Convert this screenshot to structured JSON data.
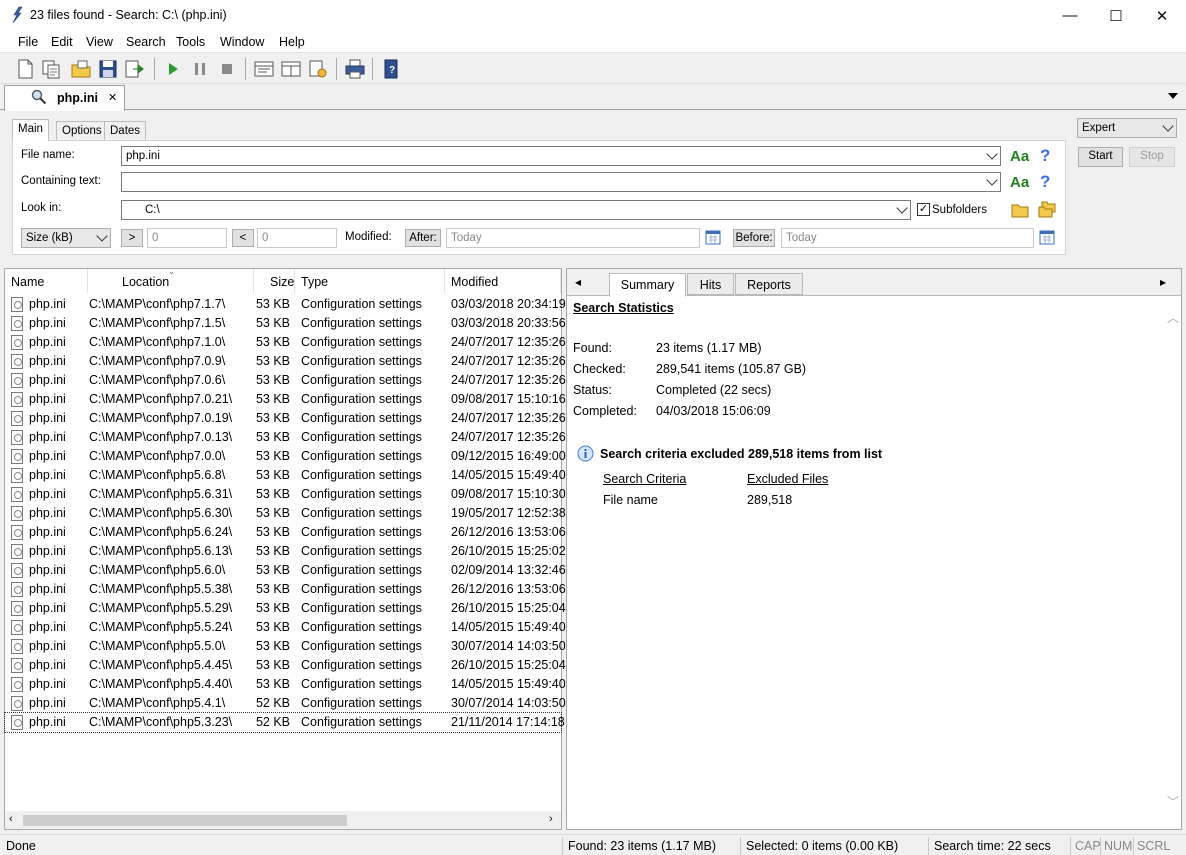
{
  "window": {
    "title": "23 files found - Search: C:\\ (php.ini)",
    "minimize": "—",
    "maximize": "☐",
    "close": "✕"
  },
  "menu": [
    "File",
    "Edit",
    "View",
    "Search",
    "Tools",
    "Window",
    "Help"
  ],
  "doc_tab": {
    "label": "php.ini",
    "close": "✕"
  },
  "criteria": {
    "tabs": [
      "Main",
      "Options",
      "Dates"
    ],
    "file_name_label": "File name:",
    "file_name_value": "php.ini",
    "containing_text_label": "Containing text:",
    "containing_text_value": "",
    "look_in_label": "Look in:",
    "look_in_value": "C:\\",
    "subfolders_label": "Subfolders",
    "subfolders_checked": true,
    "size_select": "Size (kB)",
    "gt_label": ">",
    "gt_value": "0",
    "lt_label": "<",
    "lt_value": "0",
    "modified_label": "Modified:",
    "after_label": "After:",
    "after_value": "Today",
    "before_label": "Before:",
    "before_value": "Today",
    "aa": "Aa",
    "help": "?"
  },
  "mode_select": "Expert",
  "start_label": "Start",
  "stop_label": "Stop",
  "columns": [
    "Name",
    "Location",
    "Size",
    "Type",
    "Modified"
  ],
  "rows": [
    {
      "name": "php.ini",
      "location": "C:\\MAMP\\conf\\php7.1.7\\",
      "size": "53 KB",
      "type": "Configuration settings",
      "modified": "03/03/2018 20:34:19"
    },
    {
      "name": "php.ini",
      "location": "C:\\MAMP\\conf\\php7.1.5\\",
      "size": "53 KB",
      "type": "Configuration settings",
      "modified": "03/03/2018 20:33:56"
    },
    {
      "name": "php.ini",
      "location": "C:\\MAMP\\conf\\php7.1.0\\",
      "size": "53 KB",
      "type": "Configuration settings",
      "modified": "24/07/2017 12:35:26"
    },
    {
      "name": "php.ini",
      "location": "C:\\MAMP\\conf\\php7.0.9\\",
      "size": "53 KB",
      "type": "Configuration settings",
      "modified": "24/07/2017 12:35:26"
    },
    {
      "name": "php.ini",
      "location": "C:\\MAMP\\conf\\php7.0.6\\",
      "size": "53 KB",
      "type": "Configuration settings",
      "modified": "24/07/2017 12:35:26"
    },
    {
      "name": "php.ini",
      "location": "C:\\MAMP\\conf\\php7.0.21\\",
      "size": "53 KB",
      "type": "Configuration settings",
      "modified": "09/08/2017 15:10:16"
    },
    {
      "name": "php.ini",
      "location": "C:\\MAMP\\conf\\php7.0.19\\",
      "size": "53 KB",
      "type": "Configuration settings",
      "modified": "24/07/2017 12:35:26"
    },
    {
      "name": "php.ini",
      "location": "C:\\MAMP\\conf\\php7.0.13\\",
      "size": "53 KB",
      "type": "Configuration settings",
      "modified": "24/07/2017 12:35:26"
    },
    {
      "name": "php.ini",
      "location": "C:\\MAMP\\conf\\php7.0.0\\",
      "size": "53 KB",
      "type": "Configuration settings",
      "modified": "09/12/2015 16:49:00"
    },
    {
      "name": "php.ini",
      "location": "C:\\MAMP\\conf\\php5.6.8\\",
      "size": "53 KB",
      "type": "Configuration settings",
      "modified": "14/05/2015 15:49:40"
    },
    {
      "name": "php.ini",
      "location": "C:\\MAMP\\conf\\php5.6.31\\",
      "size": "53 KB",
      "type": "Configuration settings",
      "modified": "09/08/2017 15:10:30"
    },
    {
      "name": "php.ini",
      "location": "C:\\MAMP\\conf\\php5.6.30\\",
      "size": "53 KB",
      "type": "Configuration settings",
      "modified": "19/05/2017 12:52:38"
    },
    {
      "name": "php.ini",
      "location": "C:\\MAMP\\conf\\php5.6.24\\",
      "size": "53 KB",
      "type": "Configuration settings",
      "modified": "26/12/2016 13:53:06"
    },
    {
      "name": "php.ini",
      "location": "C:\\MAMP\\conf\\php5.6.13\\",
      "size": "53 KB",
      "type": "Configuration settings",
      "modified": "26/10/2015 15:25:02"
    },
    {
      "name": "php.ini",
      "location": "C:\\MAMP\\conf\\php5.6.0\\",
      "size": "53 KB",
      "type": "Configuration settings",
      "modified": "02/09/2014 13:32:46"
    },
    {
      "name": "php.ini",
      "location": "C:\\MAMP\\conf\\php5.5.38\\",
      "size": "53 KB",
      "type": "Configuration settings",
      "modified": "26/12/2016 13:53:06"
    },
    {
      "name": "php.ini",
      "location": "C:\\MAMP\\conf\\php5.5.29\\",
      "size": "53 KB",
      "type": "Configuration settings",
      "modified": "26/10/2015 15:25:04"
    },
    {
      "name": "php.ini",
      "location": "C:\\MAMP\\conf\\php5.5.24\\",
      "size": "53 KB",
      "type": "Configuration settings",
      "modified": "14/05/2015 15:49:40"
    },
    {
      "name": "php.ini",
      "location": "C:\\MAMP\\conf\\php5.5.0\\",
      "size": "53 KB",
      "type": "Configuration settings",
      "modified": "30/07/2014 14:03:50"
    },
    {
      "name": "php.ini",
      "location": "C:\\MAMP\\conf\\php5.4.45\\",
      "size": "53 KB",
      "type": "Configuration settings",
      "modified": "26/10/2015 15:25:04"
    },
    {
      "name": "php.ini",
      "location": "C:\\MAMP\\conf\\php5.4.40\\",
      "size": "53 KB",
      "type": "Configuration settings",
      "modified": "14/05/2015 15:49:40"
    },
    {
      "name": "php.ini",
      "location": "C:\\MAMP\\conf\\php5.4.1\\",
      "size": "52 KB",
      "type": "Configuration settings",
      "modified": "30/07/2014 14:03:50"
    },
    {
      "name": "php.ini",
      "location": "C:\\MAMP\\conf\\php5.3.23\\",
      "size": "52 KB",
      "type": "Configuration settings",
      "modified": "21/11/2014 17:14:18"
    }
  ],
  "results_tabs": [
    "Summary",
    "Hits",
    "Reports"
  ],
  "summary": {
    "heading": "Search Statistics",
    "found_label": "Found:",
    "found_value": "23 items (1.17 MB)",
    "checked_label": "Checked:",
    "checked_value": "289,541 items (105.87 GB)",
    "status_label": "Status:",
    "status_value": "Completed (22 secs)",
    "completed_label": "Completed:",
    "completed_value": "04/03/2018 15:06:09",
    "excluded_note": "Search criteria excluded 289,518 items from list",
    "criteria_header": "Search Criteria",
    "excluded_header": "Excluded Files",
    "criteria_name": "File name",
    "criteria_count": "289,518"
  },
  "statusbar": {
    "left": "Done",
    "found": "Found: 23 items (1.17 MB)",
    "selected": "Selected: 0 items (0.00 KB)",
    "time": "Search time: 22 secs",
    "cap": "CAP",
    "num": "NUM",
    "scrl": "SCRL"
  },
  "colors": {
    "accent_green": "#208020",
    "help_blue": "#3b6fd6",
    "info_blue": "#3b7bd6"
  }
}
